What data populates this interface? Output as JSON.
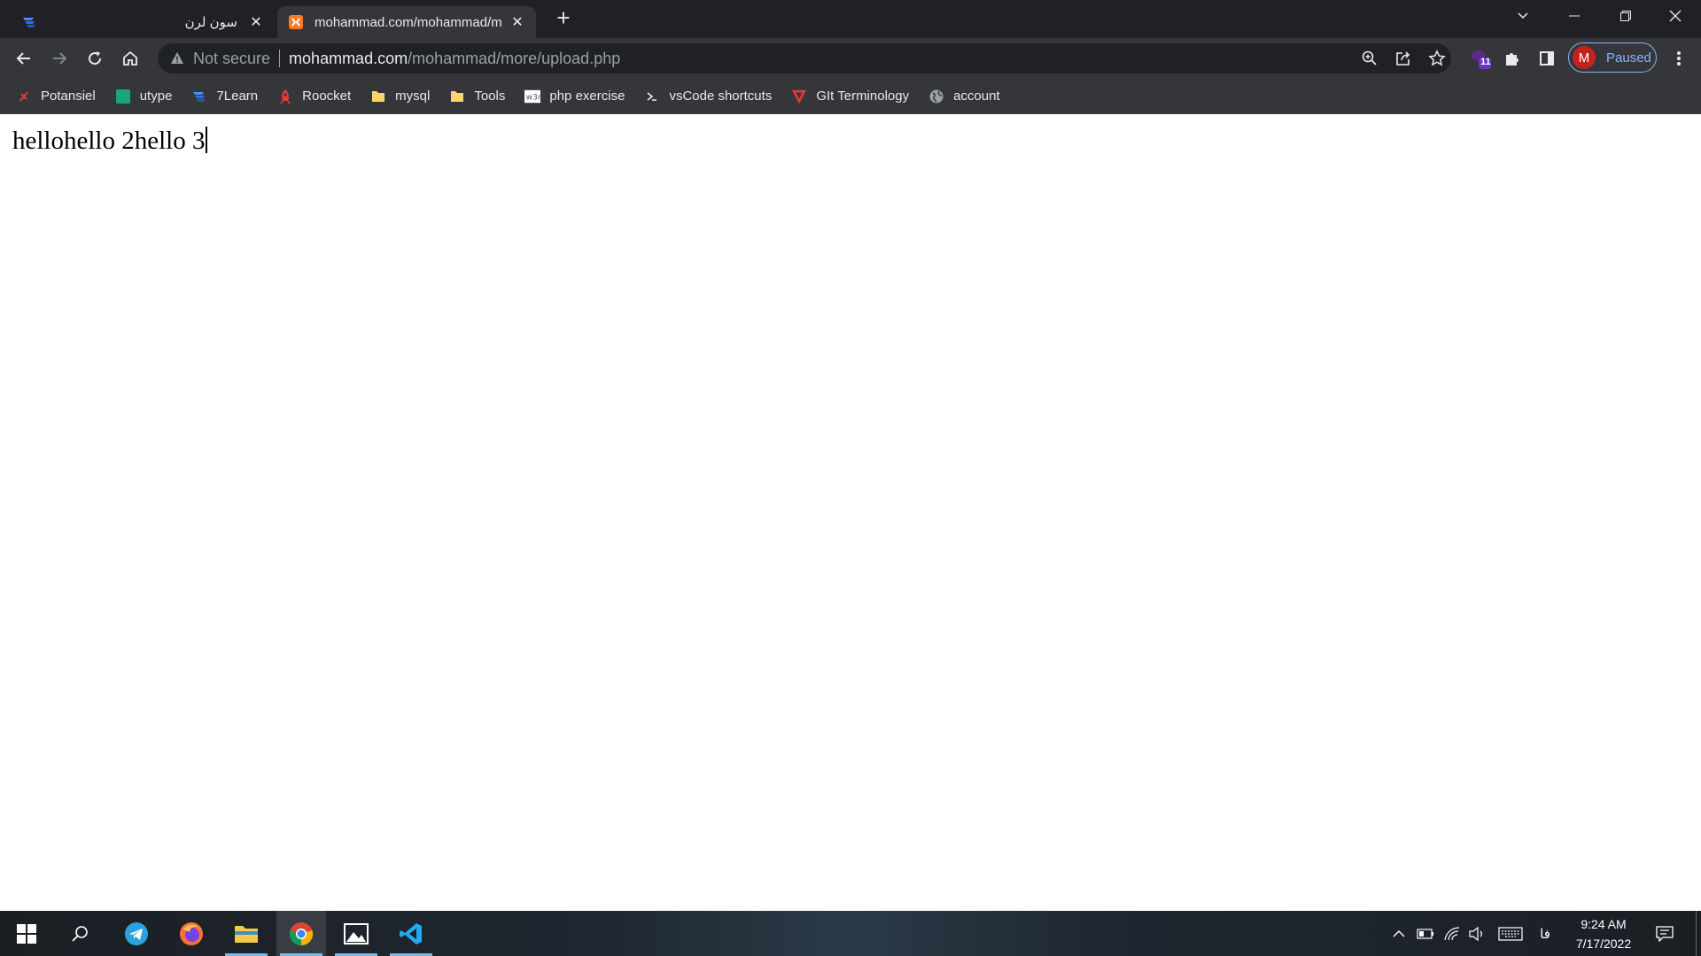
{
  "tabs": [
    {
      "title": "سون لرن",
      "favicon": "sevenlearn-logo",
      "active": false
    },
    {
      "title": "mohammad.com/mohammad/m",
      "favicon": "xampp-logo",
      "active": true
    }
  ],
  "newtab_label": "+",
  "address": {
    "security_label": "Not secure",
    "host": "mohammad.com",
    "path": "/mohammad/more/upload.php"
  },
  "profile": {
    "initial": "M",
    "status": "Paused"
  },
  "extension_badge": "11",
  "bookmarks": [
    {
      "label": "Potansiel",
      "icon": "potansiel-icon"
    },
    {
      "label": "utype",
      "icon": "utype-icon"
    },
    {
      "label": "7Learn",
      "icon": "sevenlearn-icon"
    },
    {
      "label": "Roocket",
      "icon": "roocket-icon"
    },
    {
      "label": "mysql",
      "icon": "folder-icon"
    },
    {
      "label": "Tools",
      "icon": "folder-icon"
    },
    {
      "label": "php exercise",
      "icon": "w3r-icon"
    },
    {
      "label": "vsCode shortcuts",
      "icon": "vscode-shortcuts-icon"
    },
    {
      "label": "GIt Terminology",
      "icon": "git-icon"
    },
    {
      "label": "account",
      "icon": "globe-icon"
    }
  ],
  "page": {
    "text": "hellohello 2hello 3"
  },
  "taskbar": {
    "apps": [
      "start",
      "search",
      "telegram",
      "firefox",
      "file-explorer",
      "chrome",
      "photos",
      "vscode"
    ],
    "language": "فا",
    "time": "9:24 AM",
    "date": "7/17/2022"
  },
  "colors": {
    "frame": "#202124",
    "toolbar": "#35363a",
    "accent": "#8ab4f8",
    "avatar": "#c5221f"
  }
}
